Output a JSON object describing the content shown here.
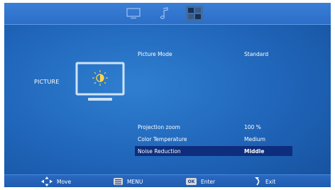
{
  "tabs": [
    {
      "icon": "monitor-icon",
      "active": false
    },
    {
      "icon": "music-note-icon",
      "active": false
    },
    {
      "icon": "grid-icon",
      "active": true
    }
  ],
  "section_label": "PICTURE",
  "menu": {
    "picture_mode": {
      "label": "Picture Mode",
      "value": "Standard"
    },
    "projection_zoom": {
      "label": "Projection zoom",
      "value": "100 %"
    },
    "color_temperature": {
      "label": "Color Temperature",
      "value": "Medium"
    },
    "noise_reduction": {
      "label": "Noise Reduction",
      "value": "Middle"
    }
  },
  "hints": {
    "move": {
      "icon": "dpad-icon",
      "label": "Move"
    },
    "menu": {
      "icon": "menu-icon",
      "label": "MENU"
    },
    "enter": {
      "icon": "ok-icon",
      "icon_text": "OK",
      "label": "Enter"
    },
    "exit": {
      "icon": "return-icon",
      "label": "Exit"
    }
  },
  "colors": {
    "background": "#1f64b8",
    "selection": "#0e2d7c",
    "text": "#ffffff"
  }
}
